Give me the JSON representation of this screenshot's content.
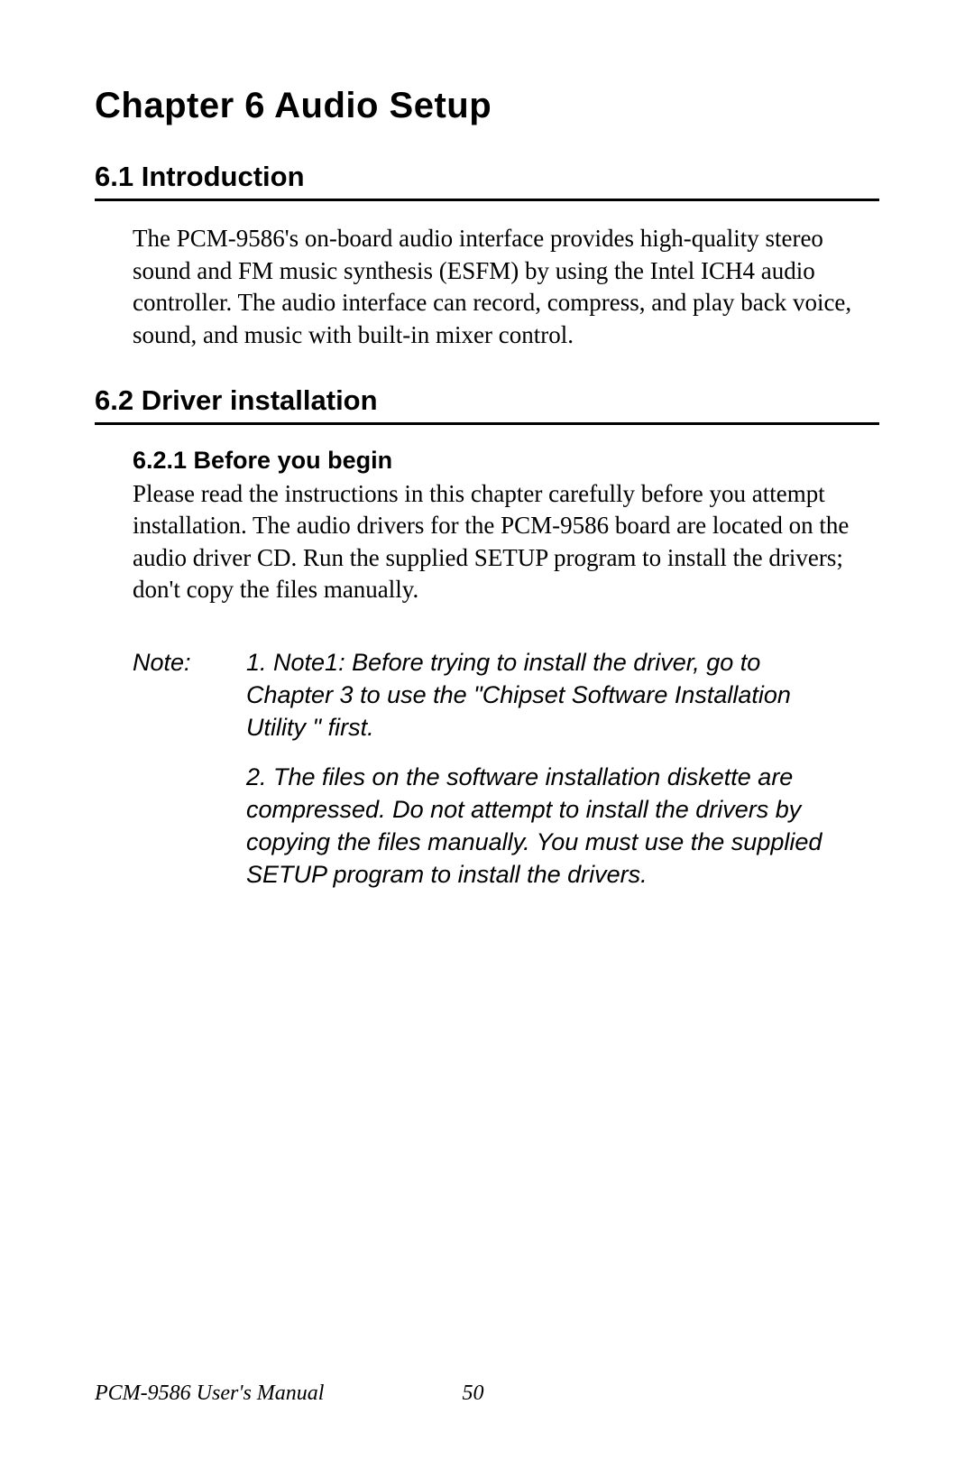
{
  "chapter": {
    "title": "Chapter 6  Audio Setup"
  },
  "sections": {
    "s1": {
      "header": "6.1  Introduction",
      "body": "The PCM-9586's on-board audio interface provides high-quality stereo sound and FM music synthesis (ESFM) by using the Intel ICH4 audio controller. The audio interface can record, compress, and play back voice, sound, and music with built-in mixer control."
    },
    "s2": {
      "header": "6.2  Driver installation",
      "sub1": {
        "header": "6.2.1 Before you begin",
        "body": "Please read the instructions in this chapter carefully before you attempt installation. The audio drivers for the PCM-9586 board are located on the audio driver CD. Run the supplied SETUP program to install the drivers; don't copy the files manually."
      }
    }
  },
  "note": {
    "label": "Note:",
    "items": {
      "n1": "1. Note1: Before trying to install the driver, go to Chapter 3 to use the \"Chipset Software Installation Utility \" first.",
      "n2": "2. The files on the software installation diskette are compressed. Do not attempt to install the drivers by copying the files manually. You must use the supplied SETUP program to install the drivers."
    }
  },
  "footer": {
    "manual": "PCM-9586 User's Manual",
    "page": "50"
  }
}
